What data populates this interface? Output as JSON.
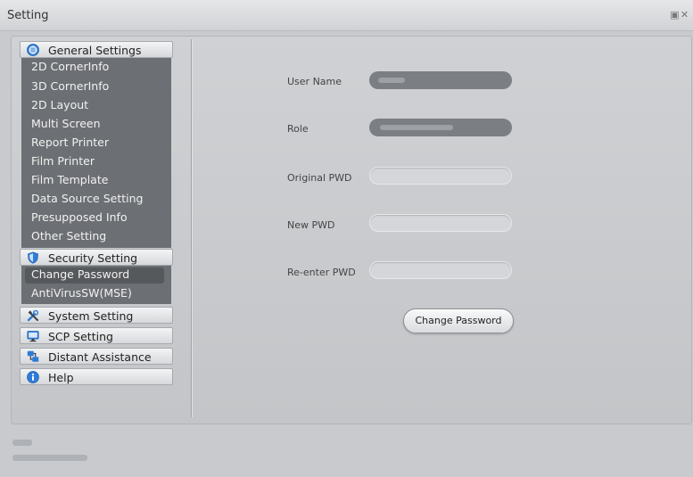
{
  "window": {
    "title": "Setting"
  },
  "nav": {
    "general": {
      "label": "General Settings",
      "items": [
        "2D CornerInfo",
        "3D CornerInfo",
        "2D Layout",
        "Multi Screen",
        "Report Printer",
        "Film Printer",
        "Film Template",
        "Data Source Setting",
        "Presupposed Info",
        "Other Setting"
      ]
    },
    "security": {
      "label": "Security Setting",
      "items": [
        "Change Password",
        "AntiVirusSW(MSE)"
      ],
      "selected": "Change Password"
    },
    "system": {
      "label": "System Setting"
    },
    "scp": {
      "label": "SCP Setting"
    },
    "distant": {
      "label": "Distant Assistance"
    },
    "help": {
      "label": "Help"
    }
  },
  "form": {
    "username_label": "User Name",
    "role_label": "Role",
    "original_pwd_label": "Original PWD",
    "new_pwd_label": "New PWD",
    "reenter_pwd_label": "Re-enter PWD",
    "submit_label": "Change Password"
  },
  "colors": {
    "accent": "#3a7fd0",
    "panel_bg": "#6c6f73",
    "selected_bg": "#56595c"
  }
}
